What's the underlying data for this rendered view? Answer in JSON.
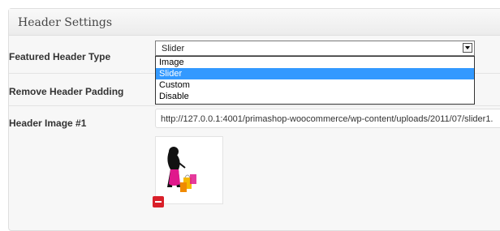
{
  "panel": {
    "title": "Header Settings"
  },
  "fields": {
    "featured_header_type": {
      "label": "Featured Header Type",
      "value": "Slider",
      "options": [
        "Image",
        "Slider",
        "Custom",
        "Disable"
      ],
      "selected_option": "Slider"
    },
    "remove_header_padding": {
      "label": "Remove Header Padding"
    },
    "header_image_1": {
      "label": "Header Image #1",
      "value": "http://127.0.0.1:4001/primashop-woocommerce/wp-content/uploads/2011/07/slider1.",
      "thumbnail_icon": "shopping-woman-image"
    }
  },
  "icons": {
    "remove": "minus-icon"
  },
  "colors": {
    "selected_option": "#3399ff",
    "remove_button": "#d9202a"
  }
}
